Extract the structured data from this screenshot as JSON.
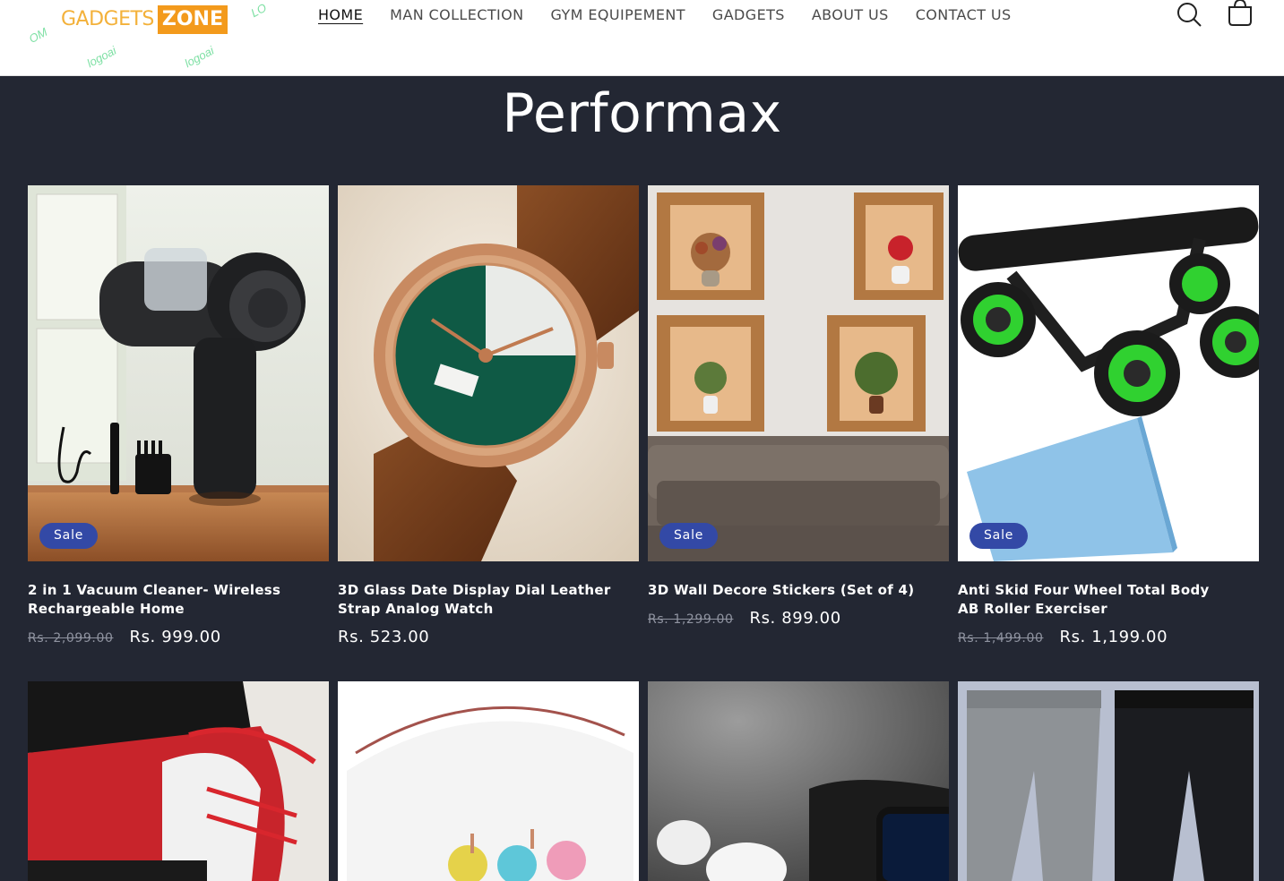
{
  "header": {
    "logo": {
      "word1": "GADGETS",
      "word2": "ZONE"
    },
    "nav": [
      {
        "label": "HOME",
        "active": true
      },
      {
        "label": "MAN COLLECTION",
        "active": false
      },
      {
        "label": "GYM EQUIPEMENT",
        "active": false
      },
      {
        "label": "GADGETS",
        "active": false
      },
      {
        "label": "ABOUT US",
        "active": false
      },
      {
        "label": "CONTACT US",
        "active": false
      }
    ],
    "icons": [
      "search-icon",
      "cart-icon"
    ]
  },
  "section": {
    "title": "Performax"
  },
  "products": [
    {
      "title": "2 in 1 Vacuum Cleaner- Wireless Rechargeable Home",
      "badge": "Sale",
      "price_old": "Rs. 2,099.00",
      "price_new": "Rs. 999.00"
    },
    {
      "title": "3D Glass Date Display Dial Leather Strap Analog Watch",
      "badge": "",
      "price_old": "",
      "price_new": "Rs. 523.00"
    },
    {
      "title": "3D Wall Decore Stickers (Set of 4)",
      "badge": "Sale",
      "price_old": "Rs. 1,299.00",
      "price_new": "Rs. 899.00"
    },
    {
      "title": "Anti Skid Four Wheel Total Body AB Roller Exerciser",
      "badge": "Sale",
      "price_old": "Rs. 1,499.00",
      "price_new": "Rs. 1,199.00"
    }
  ],
  "colors": {
    "page_bg": "#232733",
    "badge": "#3349a6",
    "header_bg": "#ffffff"
  }
}
